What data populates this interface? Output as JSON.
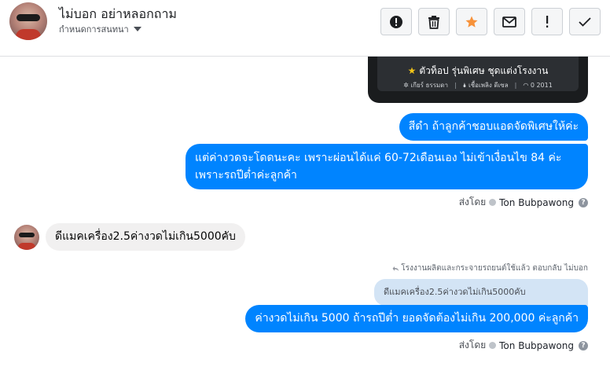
{
  "header": {
    "name": "ไม่บอก อย่าหลอกถาม",
    "subtitle": "กำหนดการสนทนา",
    "actions": [
      {
        "icon": "exclamation-circle-icon"
      },
      {
        "icon": "trash-icon"
      },
      {
        "icon": "star-icon"
      },
      {
        "icon": "envelope-icon"
      },
      {
        "icon": "exclamation-icon"
      },
      {
        "icon": "checkmark-icon"
      }
    ]
  },
  "car_card": {
    "line1": "ตัวท็อป รุ่นพิเศษ ชุดแต่งโรงงาน",
    "gear": "✲ เกียร์ ธรรมดา",
    "fuel": "🌢 เชื้อเพลิง ดีเซล",
    "mileage": "◠ 0 2011"
  },
  "messages": {
    "m1": "สีดำ ถ้าลูกค้าชอบแอดจัดพิเศษให้ค่ะ",
    "m2": "แต่ค่างวดจะโดดนะคะ เพราะผ่อนได้แค่ 60-72เดือนเอง ไม่เข้าเงื่อนไข 84 ค่ะ เพราะรถปีต่ำค่ะลูกค้า",
    "m3": "ดีแมคเครื่อง2.5ค่างวดไม่เกิน5000คับ",
    "reply_note": "โรงงานผลิตและกระจายรถยนต์ใช้แล้ว ตอบกลับ ไม่บอก",
    "quoted": "ดีแมคเครื่อง2.5ค่างวดไม่เกิน5000คับ",
    "m4": "ค่างวดไม่เกิน 5000 ถ้ารถปีต่ำ ยอดจัดต้องไม่เกิน 200,000 ค่ะลูกค้า"
  },
  "sent_by": {
    "label": "ส่งโดย",
    "name": "Ton Bubpawong"
  },
  "colors": {
    "outgoing": "#0084ff",
    "incoming": "#f1f0f0",
    "star": "#f7923a"
  }
}
